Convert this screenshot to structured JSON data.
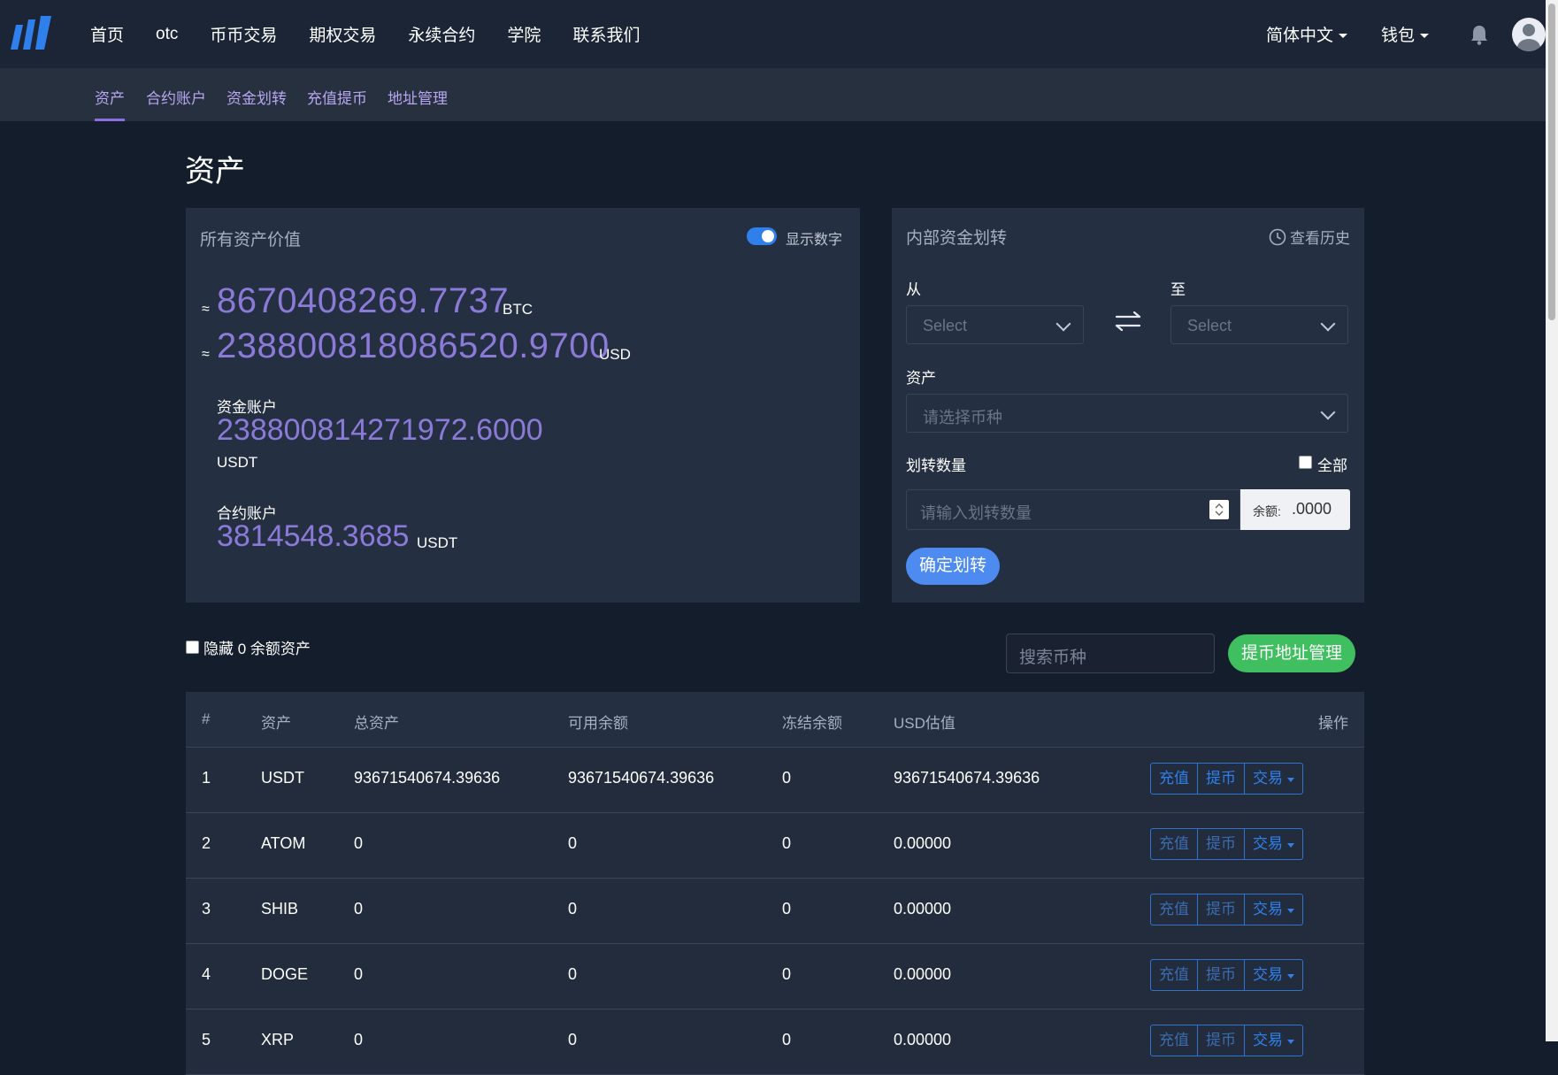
{
  "topnav": {
    "items": [
      "首页",
      "otc",
      "币币交易",
      "期权交易",
      "永续合约",
      "学院",
      "联系我们"
    ],
    "language": "简体中文",
    "wallet": "钱包"
  },
  "subnav": {
    "items": [
      "资产",
      "合约账户",
      "资金划转",
      "充值提币",
      "地址管理"
    ],
    "active": "资产"
  },
  "page_title": "资产",
  "assets_panel": {
    "title": "所有资产价值",
    "toggle_label": "显示数字",
    "toggle_on": true,
    "approx_symbol": "≈",
    "btc_value": "8670408269.7737",
    "btc_unit": "BTC",
    "usd_value": "238800818086520.9700",
    "usd_unit": "USD",
    "fund_account_label": "资金账户",
    "fund_account_value": "238800814271972.6000",
    "fund_account_unit": "USDT",
    "contract_account_label": "合约账户",
    "contract_account_value": "3814548.3685",
    "contract_account_unit": "USDT"
  },
  "transfer_panel": {
    "title": "内部资金划转",
    "history_label": "查看历史",
    "from_label": "从",
    "to_label": "至",
    "from_placeholder": "Select",
    "to_placeholder": "Select",
    "asset_label": "资产",
    "asset_placeholder": "请选择币种",
    "amount_label": "划转数量",
    "all_label": "全部",
    "amount_placeholder": "请输入划转数量",
    "balance_label": "余额:",
    "balance_value": ".0000",
    "confirm_label": "确定划转"
  },
  "filters": {
    "hide_zero_label": "隐藏 0 余额资产",
    "search_placeholder": "搜索币种",
    "address_button": "提币地址管理"
  },
  "table": {
    "headers": [
      "#",
      "资产",
      "总资产",
      "可用余额",
      "冻结余额",
      "USD估值",
      "操作"
    ],
    "action_labels": [
      "充值",
      "提币",
      "交易"
    ],
    "rows": [
      {
        "index": "1",
        "asset": "USDT",
        "total": "93671540674.39636",
        "available": "93671540674.39636",
        "frozen": "0",
        "usd": "93671540674.39636"
      },
      {
        "index": "2",
        "asset": "ATOM",
        "total": "0",
        "available": "0",
        "frozen": "0",
        "usd": "0.00000"
      },
      {
        "index": "3",
        "asset": "SHIB",
        "total": "0",
        "available": "0",
        "frozen": "0",
        "usd": "0.00000"
      },
      {
        "index": "4",
        "asset": "DOGE",
        "total": "0",
        "available": "0",
        "frozen": "0",
        "usd": "0.00000"
      },
      {
        "index": "5",
        "asset": "XRP",
        "total": "0",
        "available": "0",
        "frozen": "0",
        "usd": "0.00000"
      }
    ]
  },
  "colors": {
    "background": "#141d2b",
    "accent_purple": "#8c7ad8",
    "accent_blue": "#2f80ed",
    "success_green": "#3fbf5f"
  },
  "icons": [
    "logo-icon",
    "bell-icon",
    "avatar-icon",
    "clock-icon",
    "swap-arrows-icon",
    "chevron-down-icon"
  ]
}
